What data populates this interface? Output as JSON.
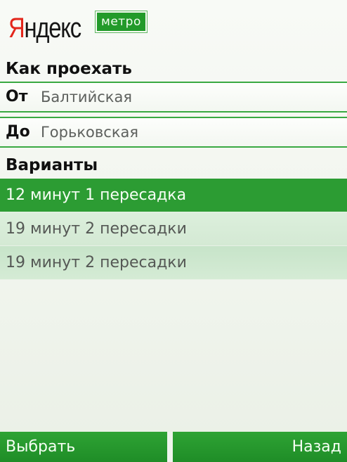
{
  "header": {
    "logo_first": "Я",
    "logo_rest": "ндекс",
    "logo_badge": "метро"
  },
  "route": {
    "title": "Как проехать",
    "from_label": "От",
    "from_value": "Балтийская",
    "to_label": "До",
    "to_value": "Горьковская"
  },
  "variants": {
    "title": "Варианты",
    "items": [
      {
        "label": "12 минут 1 пересадка",
        "selected": true
      },
      {
        "label": "19 минут 2 пересадки",
        "selected": false
      },
      {
        "label": "19 минут 2 пересадки",
        "selected": false
      }
    ]
  },
  "softkeys": {
    "left": "Выбрать",
    "right": "Назад"
  },
  "colors": {
    "accent_green": "#2c9c33",
    "logo_red": "#e3261b",
    "text_dark": "#111111",
    "text_muted": "#5d605d"
  }
}
